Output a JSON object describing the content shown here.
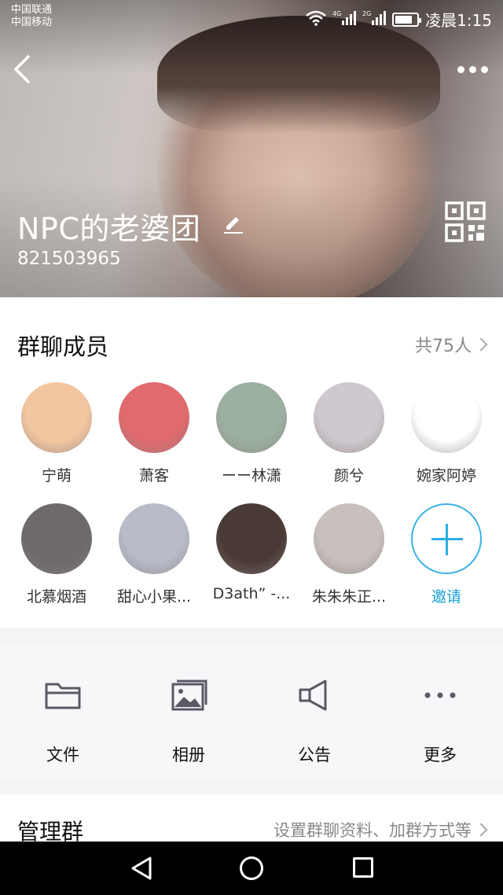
{
  "status_bar": {
    "carrier_1": "中国联通",
    "carrier_2": "中国移动",
    "network_1": "4G",
    "network_2": "2G",
    "time": "凌晨1:15",
    "battery_level": 0.8
  },
  "header": {
    "group_name": "NPC的老婆团",
    "group_id": "821503965"
  },
  "members": {
    "title": "群聊成员",
    "count": "共75人",
    "items": [
      {
        "name": "宁萌",
        "color": "#f2c6a0"
      },
      {
        "name": "萧客",
        "color": "#e06a6e"
      },
      {
        "name": "ーー林潇",
        "color": "#9bb0a0"
      },
      {
        "name": "颜兮",
        "color": "#cfc9cf"
      },
      {
        "name": "婉家阿婷",
        "color": "#ffffff"
      },
      {
        "name": "北慕烟酒",
        "color": "#6e6a6a"
      },
      {
        "name": "甜心小果...",
        "color": "#b7bcc8"
      },
      {
        "name": "D3ath” -...",
        "color": "#4a3a36"
      },
      {
        "name": "朱朱朱正...",
        "color": "#c8c0bd"
      }
    ],
    "invite_label": "邀请"
  },
  "actions": [
    {
      "label": "文件",
      "icon": "folder-icon"
    },
    {
      "label": "相册",
      "icon": "album-icon"
    },
    {
      "label": "公告",
      "icon": "megaphone-icon"
    },
    {
      "label": "更多",
      "icon": "more-dots-icon"
    }
  ],
  "manage": {
    "title": "管理群",
    "description": "设置群聊资料、加群方式等"
  },
  "colors": {
    "accent": "#2aaee3",
    "actions_bg": "#f7f7f9"
  }
}
